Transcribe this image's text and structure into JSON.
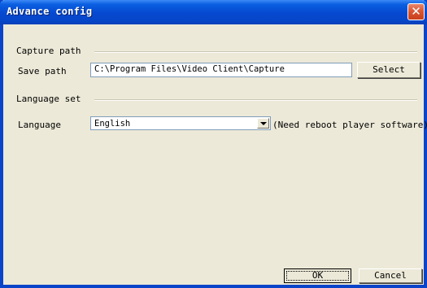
{
  "window": {
    "title": "Advance config",
    "close_glyph": "✕"
  },
  "capture": {
    "section_title": "Capture path",
    "save_path_label": "Save path",
    "save_path_value": "C:\\Program Files\\Video Client\\Capture",
    "select_button": "Select"
  },
  "language": {
    "section_title": "Language set",
    "label": "Language",
    "selected": "English",
    "note": "(Need reboot player software)"
  },
  "footer": {
    "ok_button": "OK",
    "cancel_button": "Cancel"
  },
  "colors": {
    "titlebar": "#0648d0",
    "dialog_bg": "#ece9d8",
    "close_button": "#d8532f"
  },
  "icons": {
    "close": "close-icon",
    "dropdown": "chevron-down-icon"
  }
}
